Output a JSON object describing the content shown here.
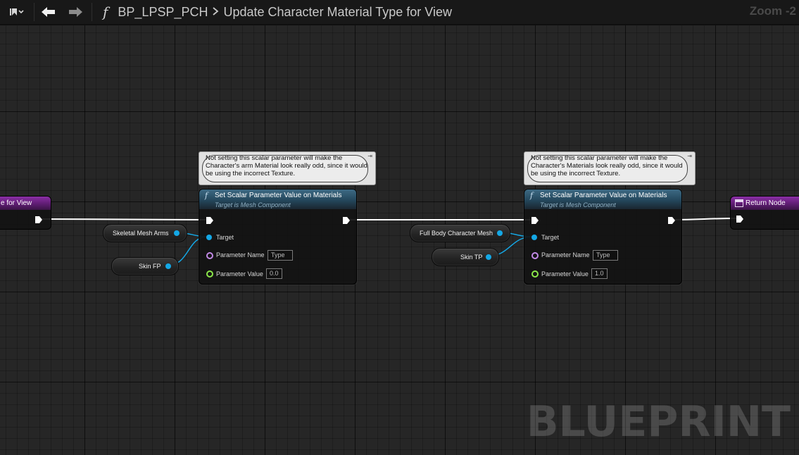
{
  "toolbar": {
    "breadcrumb_asset": "BP_LPSP_PCH",
    "breadcrumb_function": "Update Character Material Type for View",
    "zoom": "Zoom -2"
  },
  "entry_node": {
    "title_partial": "e for View"
  },
  "return_node": {
    "title": "Return Node"
  },
  "comments": [
    {
      "text": "Not setting this scalar parameter will make the Character's arm Material look really odd, since it would be using the incorrect Texture."
    },
    {
      "text": "Not setting this scalar parameter will make the Character's Materials look really odd, since it would be using the incorrect Texture."
    }
  ],
  "function_nodes": [
    {
      "title": "Set Scalar Parameter Value on Materials",
      "subtitle": "Target is Mesh Component",
      "target_label": "Target",
      "param_name_label": "Parameter Name",
      "param_name_value": "Type",
      "param_value_label": "Parameter Value",
      "param_value_value": "0.0"
    },
    {
      "title": "Set Scalar Parameter Value on Materials",
      "subtitle": "Target is Mesh Component",
      "target_label": "Target",
      "param_name_label": "Parameter Name",
      "param_name_value": "Type",
      "param_value_label": "Parameter Value",
      "param_value_value": "1.0"
    }
  ],
  "variables": {
    "skeletal_mesh_arms": "Skeletal Mesh Arms",
    "skin_fp": "Skin FP",
    "full_body_character_mesh": "Full Body Character Mesh",
    "skin_tp": "Skin TP"
  },
  "watermark": "BLUEPRINT",
  "colors": {
    "object_pin": "#14a8e6",
    "name_pin": "#c28ae6",
    "float_pin": "#8ce84a",
    "function_header": "#2e5670",
    "event_header": "#7a2893"
  }
}
